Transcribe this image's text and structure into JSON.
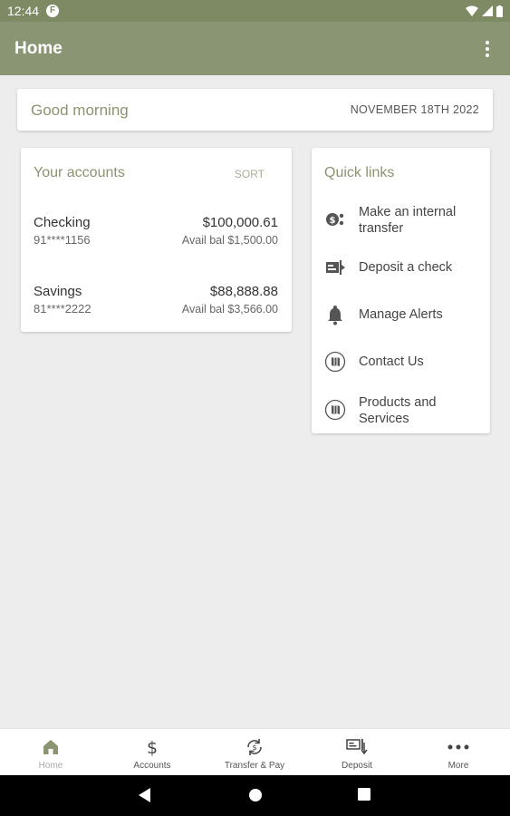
{
  "status_bar": {
    "time": "12:44",
    "app_icon": "F"
  },
  "app_bar": {
    "title": "Home"
  },
  "greeting": {
    "text": "Good morning",
    "date": "NOVEMBER 18TH 2022"
  },
  "accounts": {
    "header": "Your accounts",
    "sort_label": "SORT",
    "items": [
      {
        "name": "Checking",
        "number": "91****1156",
        "balance": "$100,000.61",
        "available": "Avail bal $1,500.00"
      },
      {
        "name": "Savings",
        "number": "81****2222",
        "balance": "$88,888.88",
        "available": "Avail bal $3,566.00"
      }
    ]
  },
  "quick_links": {
    "header": "Quick links",
    "items": [
      {
        "label": "Make an internal transfer",
        "icon": "transfer-icon"
      },
      {
        "label": "Deposit a check",
        "icon": "check-deposit-icon"
      },
      {
        "label": "Manage Alerts",
        "icon": "bell-icon"
      },
      {
        "label": "Contact Us",
        "icon": "map-icon"
      },
      {
        "label": "Products and Services",
        "icon": "map-icon"
      }
    ]
  },
  "bottom_nav": {
    "tabs": [
      {
        "label": "Home",
        "icon": "home-icon",
        "active": true
      },
      {
        "label": "Accounts",
        "icon": "dollar-icon"
      },
      {
        "label": "Transfer & Pay",
        "icon": "transfer-pay-icon"
      },
      {
        "label": "Deposit",
        "icon": "deposit-icon"
      },
      {
        "label": "More",
        "icon": "more-icon"
      }
    ]
  },
  "colors": {
    "app_bar": "#8a9574",
    "status_bar": "#7d8a63",
    "accent_text": "#8b9470",
    "background": "#ededed"
  }
}
